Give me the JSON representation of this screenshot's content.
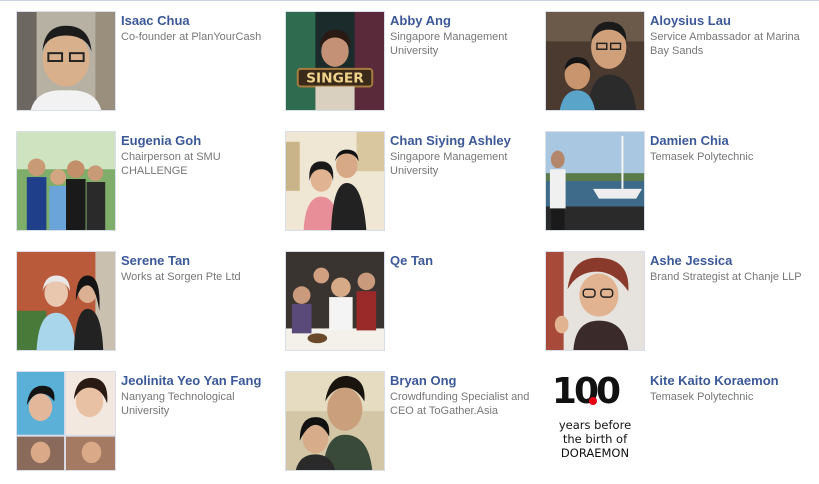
{
  "friends": [
    {
      "name": "Isaac Chua",
      "description": "Co-founder at PlanYourCash",
      "photo_icon": "portrait-photo"
    },
    {
      "name": "Abby Ang",
      "description": "Singapore Management University",
      "photo_icon": "portrait-photo"
    },
    {
      "name": "Aloysius Lau",
      "description": "Service Ambassador at Marina Bay Sands",
      "photo_icon": "portrait-photo"
    },
    {
      "name": "Eugenia Goh",
      "description": "Chairperson at SMU CHALLENGE",
      "photo_icon": "group-photo"
    },
    {
      "name": "Chan Siying Ashley",
      "description": "Singapore Management University",
      "photo_icon": "portrait-photo"
    },
    {
      "name": "Damien Chia",
      "description": "Temasek Polytechnic",
      "photo_icon": "boat-photo"
    },
    {
      "name": "Serene Tan",
      "description": "Works at Sorgen Pte Ltd",
      "photo_icon": "portrait-photo"
    },
    {
      "name": "Qe Tan",
      "description": "",
      "photo_icon": "group-photo"
    },
    {
      "name": "Ashe Jessica",
      "description": "Brand Strategist at Chanje LLP",
      "photo_icon": "portrait-photo"
    },
    {
      "name": "Jeolinita Yeo Yan Fang",
      "description": "Nanyang Technological University",
      "photo_icon": "collage-photo"
    },
    {
      "name": "Bryan Ong",
      "description": "Crowdfunding Specialist and CEO at ToGather.Asia",
      "photo_icon": "portrait-photo"
    },
    {
      "name": "Kite Kaito Koraemon",
      "description": "Temasek Polytechnic",
      "photo_icon": "logo-100-years"
    }
  ],
  "logo_100": {
    "number": "100",
    "line1": "years before",
    "line2": "the birth of",
    "line3": "DORAEMON"
  },
  "photo_sign_text": "SINGER",
  "colors": {
    "name_link": "#3b5998",
    "description": "#777777",
    "logo_red": "#e60012"
  }
}
